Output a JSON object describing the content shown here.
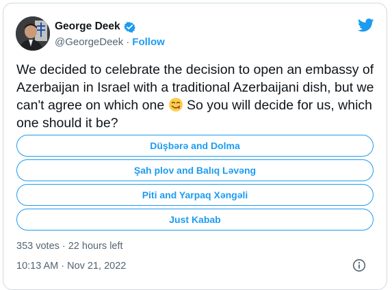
{
  "author": {
    "name": "George Deek",
    "handle": "@GeorgeDeek",
    "separator": "·",
    "follow_label": "Follow",
    "verified_icon": "verified-badge-icon"
  },
  "brand_icon": "twitter-bird-icon",
  "tweet": {
    "text_before_emoji": "We decided to celebrate the decision to open an embassy of Azerbaijan in Israel with a traditional Azerbaijani dish, but we can't agree on which one ",
    "emoji": "yum-face-emoji",
    "text_after_emoji": " So you will decide for us, which one should it be?"
  },
  "poll": {
    "options": [
      "Düşbərə and Dolma",
      "Şah plov and Balıq Ləvəng",
      "Piti and Yarpaq Xəngəli",
      "Just Kabab"
    ],
    "votes": "353 votes",
    "separator": "·",
    "time_left": "22 hours left"
  },
  "timestamp": {
    "time": "10:13 AM",
    "separator": "·",
    "date": "Nov 21, 2022"
  },
  "colors": {
    "accent": "#1d9bf0",
    "text": "#0f1419",
    "muted": "#536471",
    "border": "#cfd9de"
  }
}
